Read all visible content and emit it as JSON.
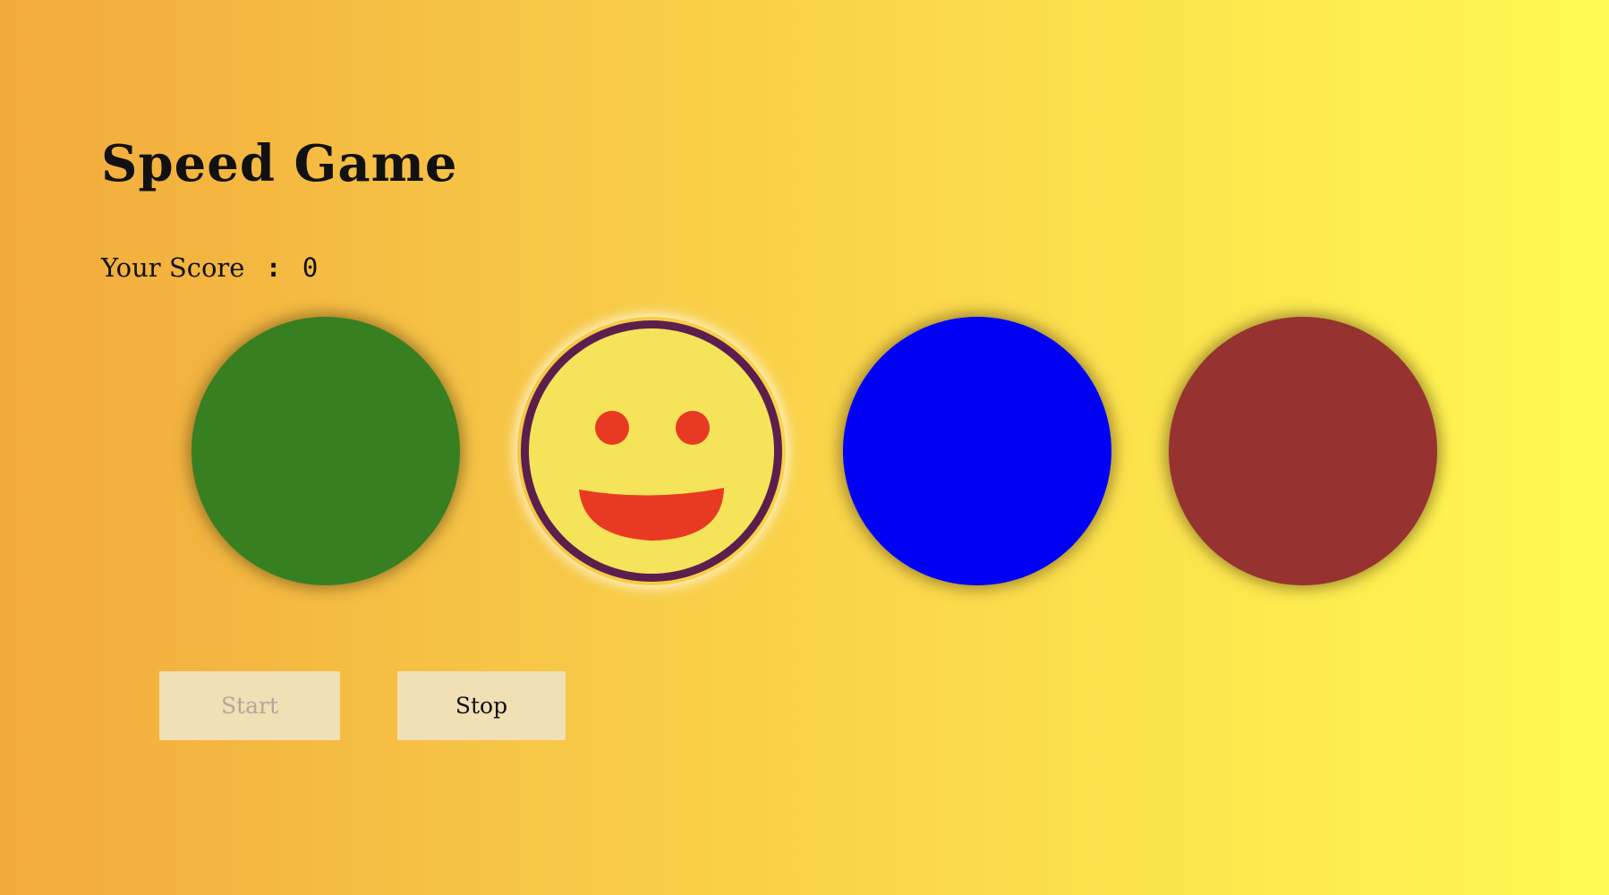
{
  "game": {
    "title": "Speed Game",
    "score_label": "Your Score",
    "score_separator": ":",
    "score_value": "0"
  },
  "circles": [
    {
      "name": "green",
      "color": "#387f22",
      "active": false
    },
    {
      "name": "smiley",
      "color": "#f5e35a",
      "active": true,
      "icon": "smiley-face-icon",
      "ring_color": "#5b1f4d",
      "mouth_color": "#e83a22"
    },
    {
      "name": "blue",
      "color": "#0000f5",
      "active": false
    },
    {
      "name": "red",
      "color": "#963330",
      "active": false
    }
  ],
  "controls": {
    "start_label": "Start",
    "start_disabled": true,
    "stop_label": "Stop"
  }
}
